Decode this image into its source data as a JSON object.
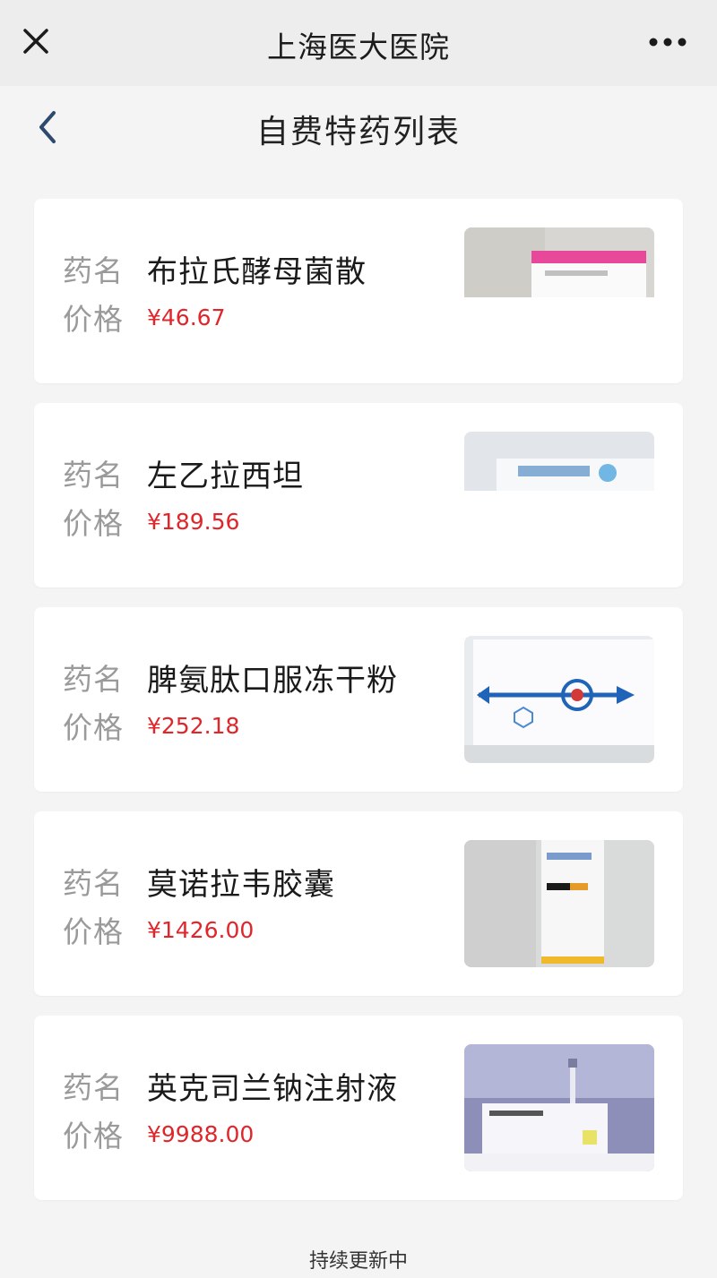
{
  "app": {
    "title": "上海医大医院"
  },
  "page": {
    "heading": "自费特药列表"
  },
  "labels": {
    "name": "药名",
    "price": "价格"
  },
  "drugs": [
    {
      "name": "布拉氏酵母菌散",
      "price": "¥46.67",
      "image": "saccharomyces-box-photo"
    },
    {
      "name": "左乙拉西坦",
      "price": "¥189.56",
      "image": "levetiracetam-box-photo"
    },
    {
      "name": "脾氨肽口服冻干粉",
      "price": "¥252.18",
      "image": "spleen-aminopeptide-box-photo"
    },
    {
      "name": "莫诺拉韦胶囊",
      "price": "¥1426.00",
      "image": "molnupiravir-box-photo"
    },
    {
      "name": "英克司兰钠注射液",
      "price": "¥9988.00",
      "image": "inclisiran-injection-photo"
    }
  ],
  "footer": {
    "text": "持续更新中"
  },
  "icons": {
    "close": "close-icon",
    "more": "more-icon",
    "back": "back-icon"
  },
  "colors": {
    "price": "#e0262a",
    "label": "#9a9a9a",
    "topbar": "#ededed",
    "background": "#f4f4f4"
  }
}
